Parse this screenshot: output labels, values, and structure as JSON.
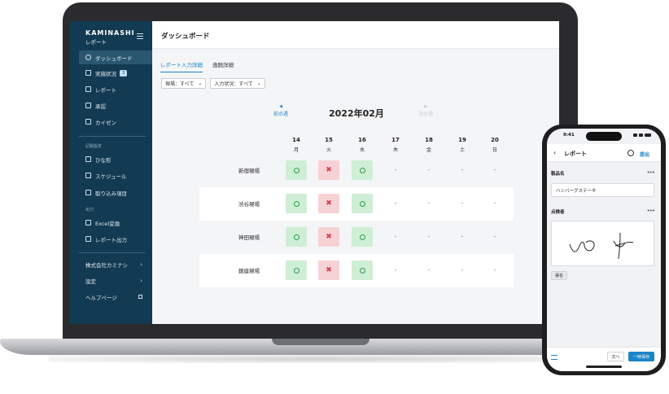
{
  "laptop": {
    "sidebar": {
      "brand": "KAMINASHI",
      "brand_sub": "レポート",
      "items": [
        {
          "label": "ダッシュボード"
        },
        {
          "label": "実施状況",
          "badge": "3"
        },
        {
          "label": "レポート"
        },
        {
          "label": "承認"
        },
        {
          "label": "カイゼン"
        }
      ],
      "section_records": "記録設定",
      "record_items": [
        {
          "label": "ひな形"
        },
        {
          "label": "スケジュール"
        },
        {
          "label": "取り込み項目"
        }
      ],
      "section_output": "出力",
      "output_items": [
        {
          "label": "Excel変換"
        },
        {
          "label": "レポート出力"
        }
      ],
      "bottom_items": [
        {
          "label": "株式会社カミナシ"
        },
        {
          "label": "設定"
        },
        {
          "label": "ヘルプページ"
        }
      ]
    },
    "header": {
      "title": "ダッシュボード"
    },
    "tabs": [
      {
        "label": "レポート入力詳細"
      },
      {
        "label": "逸脱詳細"
      }
    ],
    "filters": [
      {
        "label": "現場：すべて"
      },
      {
        "label": "入力状況：すべて"
      }
    ],
    "calendar": {
      "month": "2022年02月",
      "prev_label": "前の週",
      "next_label": "次の週",
      "days": [
        {
          "num": "14",
          "name": "月"
        },
        {
          "num": "15",
          "name": "火"
        },
        {
          "num": "16",
          "name": "水"
        },
        {
          "num": "17",
          "name": "木"
        },
        {
          "num": "18",
          "name": "金"
        },
        {
          "num": "19",
          "name": "土"
        },
        {
          "num": "20",
          "name": "日"
        }
      ],
      "dash": "-",
      "rows": [
        {
          "site": "新宿現場",
          "status": [
            "ok",
            "ng",
            "ok",
            "-",
            "-",
            "-",
            "-"
          ]
        },
        {
          "site": "渋谷現場",
          "status": [
            "ok",
            "ng",
            "ok",
            "-",
            "-",
            "-",
            "-"
          ]
        },
        {
          "site": "神田現場",
          "status": [
            "ok",
            "ng",
            "ok",
            "-",
            "-",
            "-",
            "-"
          ]
        },
        {
          "site": "銀座現場",
          "status": [
            "ok",
            "ng",
            "ok",
            "-",
            "-",
            "-",
            "-"
          ]
        }
      ]
    }
  },
  "phone": {
    "time": "9:41",
    "title": "レポート",
    "submit": "提出",
    "fields": [
      {
        "label": "製品名",
        "value": "ハンバーグステーキ"
      },
      {
        "label": "点検者"
      }
    ],
    "sign_button": "署名",
    "next_button": "次へ",
    "save_button": "一時保存"
  },
  "colors": {
    "sidebar_bg": "#123a52",
    "accent": "#1b84c8",
    "ok_bg": "#cfeed6",
    "ng_bg": "#f7d2d4"
  }
}
